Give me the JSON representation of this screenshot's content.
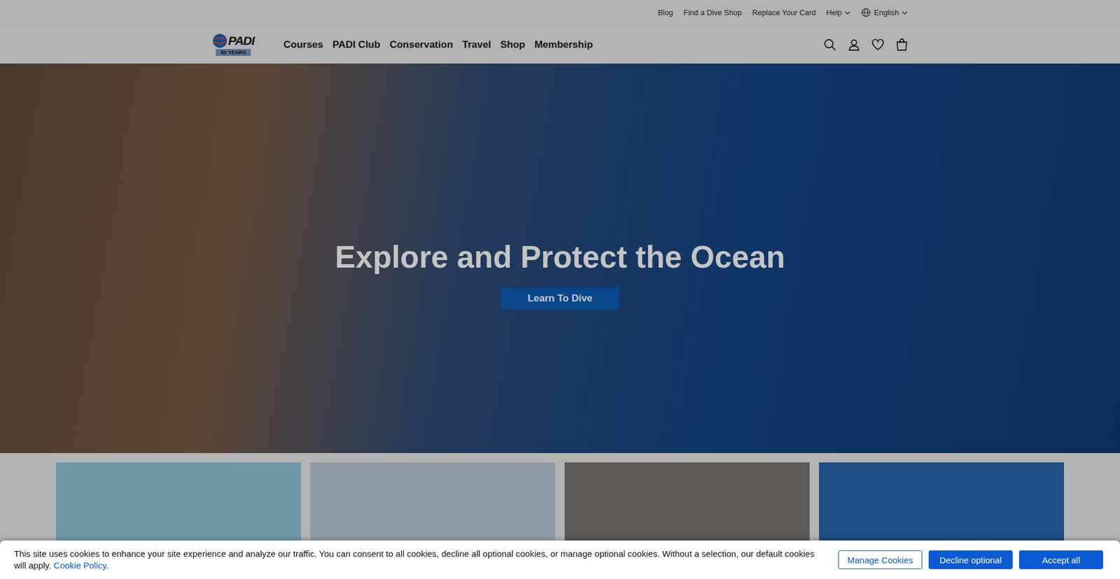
{
  "utility_links": [
    "Blog",
    "Find a Dive Shop",
    "Replace Your Card"
  ],
  "help_menu": {
    "label": "Help",
    "expanded": false
  },
  "language": {
    "label": "English",
    "expanded": false
  },
  "logo": {
    "brand": "PADI",
    "badge": "60 YEARS"
  },
  "nav": [
    "Courses",
    "PADI Club",
    "Conservation",
    "Travel",
    "Shop",
    "Membership"
  ],
  "hero": {
    "title": "Explore and Protect the Ocean",
    "button": "Learn To Dive"
  },
  "cards": [
    {
      "color": "#6f98a8"
    },
    {
      "color": "#8e9aa6"
    },
    {
      "color": "#5e5a58"
    },
    {
      "color": "#1d4f86"
    }
  ],
  "cookie_banner": {
    "text": "This site uses cookies to enhance your site experience and analyze our traffic. You can consent to all cookies, decline all optional cookies, or manage optional cookies. Without a selection, our default cookies will apply.",
    "link": "Cookie Policy",
    "after_link": ".",
    "buttons": [
      {
        "label": "Manage Cookies",
        "kind": "outline"
      },
      {
        "label": "Decline optional",
        "kind": "filled"
      },
      {
        "label": "Accept all",
        "kind": "filled"
      }
    ]
  }
}
